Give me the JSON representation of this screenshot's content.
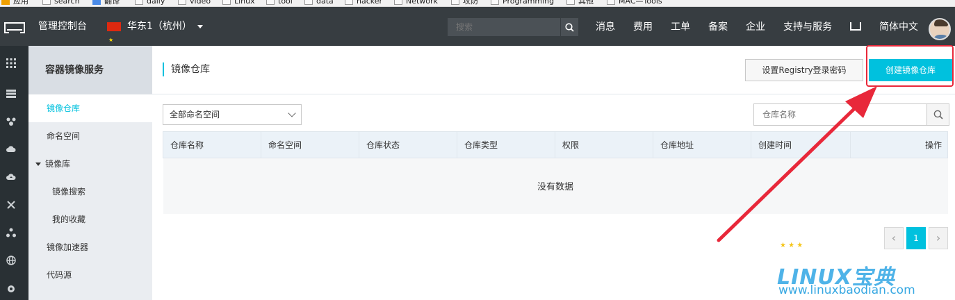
{
  "bookmarks": [
    "应用",
    "search",
    "翻译",
    "daily",
    "video",
    "Linux",
    "tool",
    "data",
    "hacker",
    "Network",
    "攻防",
    "Programming",
    "其他",
    "MAC—Tools"
  ],
  "topbar": {
    "console": "管理控制台",
    "region": "华东1（杭州）",
    "search_placeholder": "搜索",
    "nav": [
      "消息",
      "费用",
      "工单",
      "备案",
      "企业",
      "支持与服务"
    ],
    "lang": "简体中文"
  },
  "sidebar": {
    "title": "容器镜像服务",
    "items": [
      {
        "label": "镜像仓库"
      },
      {
        "label": "命名空间"
      },
      {
        "label": "镜像库"
      },
      {
        "label": "镜像搜索"
      },
      {
        "label": "我的收藏"
      },
      {
        "label": "镜像加速器"
      },
      {
        "label": "代码源"
      }
    ]
  },
  "main": {
    "title": "镜像仓库",
    "registry_password_button": "设置Registry登录密码",
    "create_repo_button": "创建镜像仓库",
    "namespace_select": "全部命名空间",
    "repo_search_placeholder": "仓库名称",
    "columns": [
      "仓库名称",
      "命名空间",
      "仓库状态",
      "仓库类型",
      "权限",
      "仓库地址",
      "创建时间",
      "操作"
    ],
    "empty_text": "没有数据",
    "pager": {
      "current": "1"
    }
  },
  "watermark": {
    "logo": "LINUX宝典",
    "url": "www.linuxbaodian.com"
  },
  "colors": {
    "accent": "#00c1de",
    "highlight": "#e8283a",
    "topbar": "#373d41"
  }
}
